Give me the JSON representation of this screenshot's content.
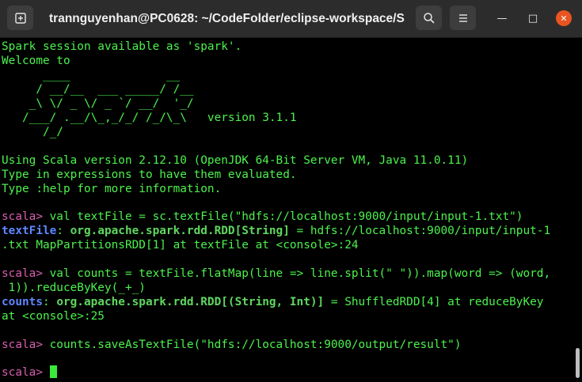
{
  "window": {
    "title": "trannguyenhan@PC0628: ~/CodeFolder/eclipse-workspace/S...",
    "new_tab_icon": "new-tab-icon",
    "search_icon": "search-icon",
    "menu_icon": "hamburger-menu-icon",
    "minimize_glyph": "—",
    "maximize_glyph": "□",
    "close_glyph": "✕"
  },
  "terminal": {
    "l1": "Spark session available as 'spark'.",
    "l2": "Welcome to",
    "logo1": "      ____              __",
    "logo2": "     / __/__  ___ _____/ /__",
    "logo3": "    _\\ \\/ _ \\/ _ `/ __/  '_/",
    "logo4": "   /___/ .__/\\_,_/_/ /_/\\_\\   version 3.1.1",
    "logo5": "      /_/",
    "l3": "Using Scala version 2.12.10 (OpenJDK 64-Bit Server VM, Java 11.0.11)",
    "l4": "Type in expressions to have them evaluated.",
    "l5": "Type :help for more information.",
    "prompt": "scala>",
    "cmd1": " val textFile = sc.textFile(\"hdfs://localhost:9000/input/input-1.txt\")",
    "res1_name": "textFile",
    "res1_colon": ": ",
    "res1_type": "org.apache.spark.rdd.RDD[String]",
    "res1_rest": " = hdfs://localhost:9000/input/input-1",
    "res1_cont": ".txt MapPartitionsRDD[1] at textFile at <console>:24",
    "cmd2": " val counts = textFile.flatMap(line => line.split(\" \")).map(word => (word,",
    "cmd2_cont": " 1)).reduceByKey(_+_)",
    "res2_name": "counts",
    "res2_colon": ": ",
    "res2_type": "org.apache.spark.rdd.RDD[(String, Int)]",
    "res2_rest": " = ShuffledRDD[4] at reduceByKey",
    "res2_cont": "at <console>:25",
    "cmd3": " counts.saveAsTextFile(\"hdfs://localhost:9000/output/result\")",
    "prompt_final": "scala> "
  }
}
